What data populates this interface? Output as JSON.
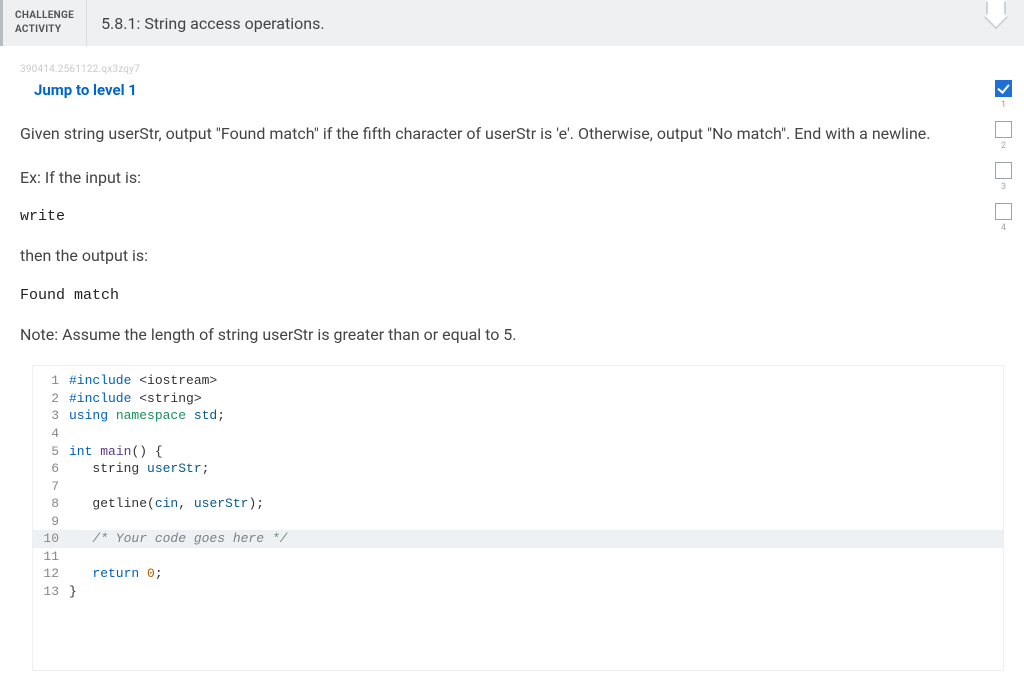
{
  "header": {
    "badge_line1": "CHALLENGE",
    "badge_line2": "ACTIVITY",
    "title": "5.8.1: String access operations."
  },
  "ref_id": "390414.2561122.qx3zqy7",
  "jump_link": "Jump to level 1",
  "problem": {
    "prompt": "Given string userStr, output \"Found match\" if the fifth character of userStr is 'e'. Otherwise, output \"No match\". End with a newline.",
    "ex_label": "Ex: If the input is:",
    "input": "write",
    "then_label": "then the output is:",
    "output": "Found match",
    "note": "Note: Assume the length of string userStr is greater than or equal to 5."
  },
  "code": {
    "lines": [
      {
        "n": "1",
        "tokens": [
          {
            "t": "#include ",
            "c": "kw"
          },
          {
            "t": "<iostream>",
            "c": ""
          }
        ]
      },
      {
        "n": "2",
        "tokens": [
          {
            "t": "#include ",
            "c": "kw"
          },
          {
            "t": "<string>",
            "c": ""
          }
        ]
      },
      {
        "n": "3",
        "tokens": [
          {
            "t": "using ",
            "c": "kw"
          },
          {
            "t": "namespace ",
            "c": "ns"
          },
          {
            "t": "std",
            "c": "id"
          },
          {
            "t": ";",
            "c": ""
          }
        ]
      },
      {
        "n": "4",
        "tokens": []
      },
      {
        "n": "5",
        "tokens": [
          {
            "t": "int ",
            "c": "kw"
          },
          {
            "t": "main",
            "c": "fn"
          },
          {
            "t": "() {",
            "c": ""
          }
        ]
      },
      {
        "n": "6",
        "tokens": [
          {
            "t": "   string ",
            "c": ""
          },
          {
            "t": "userStr",
            "c": "id"
          },
          {
            "t": ";",
            "c": ""
          }
        ]
      },
      {
        "n": "7",
        "tokens": []
      },
      {
        "n": "8",
        "tokens": [
          {
            "t": "   getline",
            "c": ""
          },
          {
            "t": "(",
            "c": ""
          },
          {
            "t": "cin",
            "c": "id"
          },
          {
            "t": ", ",
            "c": ""
          },
          {
            "t": "userStr",
            "c": "id"
          },
          {
            "t": ");",
            "c": ""
          }
        ]
      },
      {
        "n": "9",
        "tokens": []
      },
      {
        "n": "10",
        "hl": true,
        "tokens": [
          {
            "t": "   ",
            "c": ""
          },
          {
            "t": "/* Your code goes here */",
            "c": "cm"
          }
        ]
      },
      {
        "n": "11",
        "tokens": []
      },
      {
        "n": "12",
        "tokens": [
          {
            "t": "   ",
            "c": ""
          },
          {
            "t": "return ",
            "c": "kw"
          },
          {
            "t": "0",
            "c": "num"
          },
          {
            "t": ";",
            "c": ""
          }
        ]
      },
      {
        "n": "13",
        "tokens": [
          {
            "t": "}",
            "c": ""
          }
        ]
      }
    ]
  },
  "progress": {
    "steps": [
      {
        "n": "1",
        "done": true
      },
      {
        "n": "2",
        "done": false
      },
      {
        "n": "3",
        "done": false
      },
      {
        "n": "4",
        "done": false
      }
    ]
  }
}
